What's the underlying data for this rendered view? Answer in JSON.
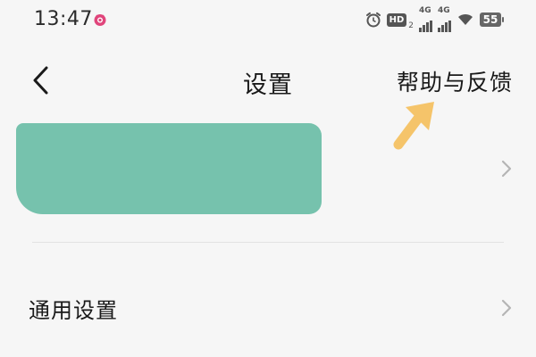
{
  "status_bar": {
    "time": "13:47",
    "hd_label": "HD",
    "hd_sub": "2",
    "network_1": "4G",
    "network_2": "4G",
    "battery_level": "55",
    "icons": [
      "app-notification-icon",
      "alarm-icon",
      "signal-icon",
      "wifi-icon",
      "battery-icon"
    ]
  },
  "header": {
    "title": "设置",
    "help_link": "帮助与反馈",
    "back_icon": "chevron-left-icon"
  },
  "colors": {
    "background": "#f6f6f6",
    "account_mask": "#76c2ad",
    "annotation_arrow": "#f5c46a",
    "chevron": "#b5b5b5"
  },
  "menu": {
    "general_settings_label": "通用设置"
  }
}
